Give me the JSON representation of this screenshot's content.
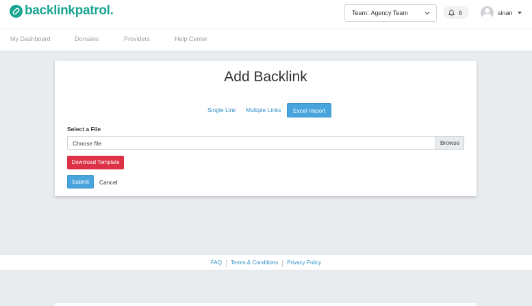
{
  "brand": {
    "name": "backlinkpatrol",
    "dot": ".",
    "color": "#1aa593"
  },
  "header": {
    "team_label": "Team:",
    "team_value": "Agency Team",
    "notifications_count": "6",
    "user_name": "sinan"
  },
  "nav": {
    "items": [
      {
        "label": "My Dashboard"
      },
      {
        "label": "Domains"
      },
      {
        "label": "Providers"
      },
      {
        "label": "Help Center"
      }
    ]
  },
  "card": {
    "title": "Add Backlink",
    "tabs": [
      {
        "label": "Single Link",
        "active": false
      },
      {
        "label": "Multiple Links",
        "active": false
      },
      {
        "label": "Excel Import",
        "active": true
      }
    ],
    "file_label": "Select a File",
    "file_placeholder": "Choose file",
    "browse_label": "Browse",
    "download_label": "Download Template",
    "submit_label": "Submit",
    "cancel_label": "Cancel"
  },
  "footer": {
    "links": [
      {
        "label": "FAQ"
      },
      {
        "label": "Terms & Conditions"
      },
      {
        "label": "Privacy Policy"
      }
    ]
  },
  "colors": {
    "accent": "#47a4dd",
    "danger": "#dc3146",
    "link": "#2f8fc7"
  }
}
